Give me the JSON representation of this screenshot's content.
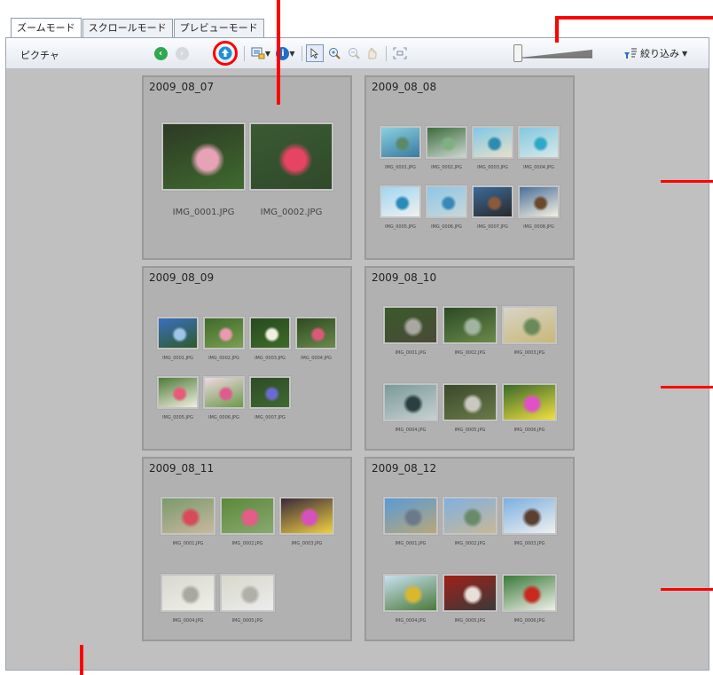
{
  "tabs": [
    {
      "label": "ズームモード",
      "active": true
    },
    {
      "label": "スクロールモード",
      "active": false
    },
    {
      "label": "プレビューモード",
      "active": false
    }
  ],
  "toolbar": {
    "label": "ピクチャ",
    "filter_label": "絞り込み",
    "icons": [
      "back-icon",
      "forward-icon",
      "up-icon",
      "view-icon",
      "info-icon",
      "select-icon",
      "zoom-in-icon",
      "zoom-out-icon",
      "pan-icon",
      "fit-icon",
      "filter-icon"
    ]
  },
  "accent_colors": {
    "annotation": "#ff0000",
    "back": "#2fa84f",
    "up": "#1e90d6",
    "info": "#1e6fc8"
  },
  "groups": [
    {
      "title": "2009_08_07",
      "captions": [
        "IMG_0001.JPG",
        "IMG_0002.JPG"
      ]
    },
    {
      "title": "2009_08_08",
      "captions": [
        "IMG_0001.JPG",
        "IMG_0002.JPG",
        "IMG_0003.JPG",
        "IMG_0004.JPG",
        "IMG_0005.JPG",
        "IMG_0006.JPG",
        "IMG_0007.JPG",
        "IMG_0008.JPG"
      ]
    },
    {
      "title": "2009_08_09",
      "captions": [
        "IMG_0001.JPG",
        "IMG_0002.JPG",
        "IMG_0003.JPG",
        "IMG_0004.JPG",
        "IMG_0005.JPG",
        "IMG_0006.JPG",
        "IMG_0007.JPG"
      ]
    },
    {
      "title": "2009_08_10",
      "captions": [
        "IMG_0001.JPG",
        "IMG_0002.JPG",
        "IMG_0003.JPG",
        "IMG_0004.JPG",
        "IMG_0005.JPG",
        "IMG_0006.JPG"
      ]
    },
    {
      "title": "2009_08_11",
      "captions": [
        "IMG_0001.JPG",
        "IMG_0002.JPG",
        "IMG_0003.JPG",
        "IMG_0004.JPG",
        "IMG_0005.JPG"
      ]
    },
    {
      "title": "2009_08_12",
      "captions": [
        "IMG_0001.JPG",
        "IMG_0002.JPG",
        "IMG_0003.JPG",
        "IMG_0004.JPG",
        "IMG_0005.JPG",
        "IMG_0006.JPG"
      ]
    }
  ]
}
